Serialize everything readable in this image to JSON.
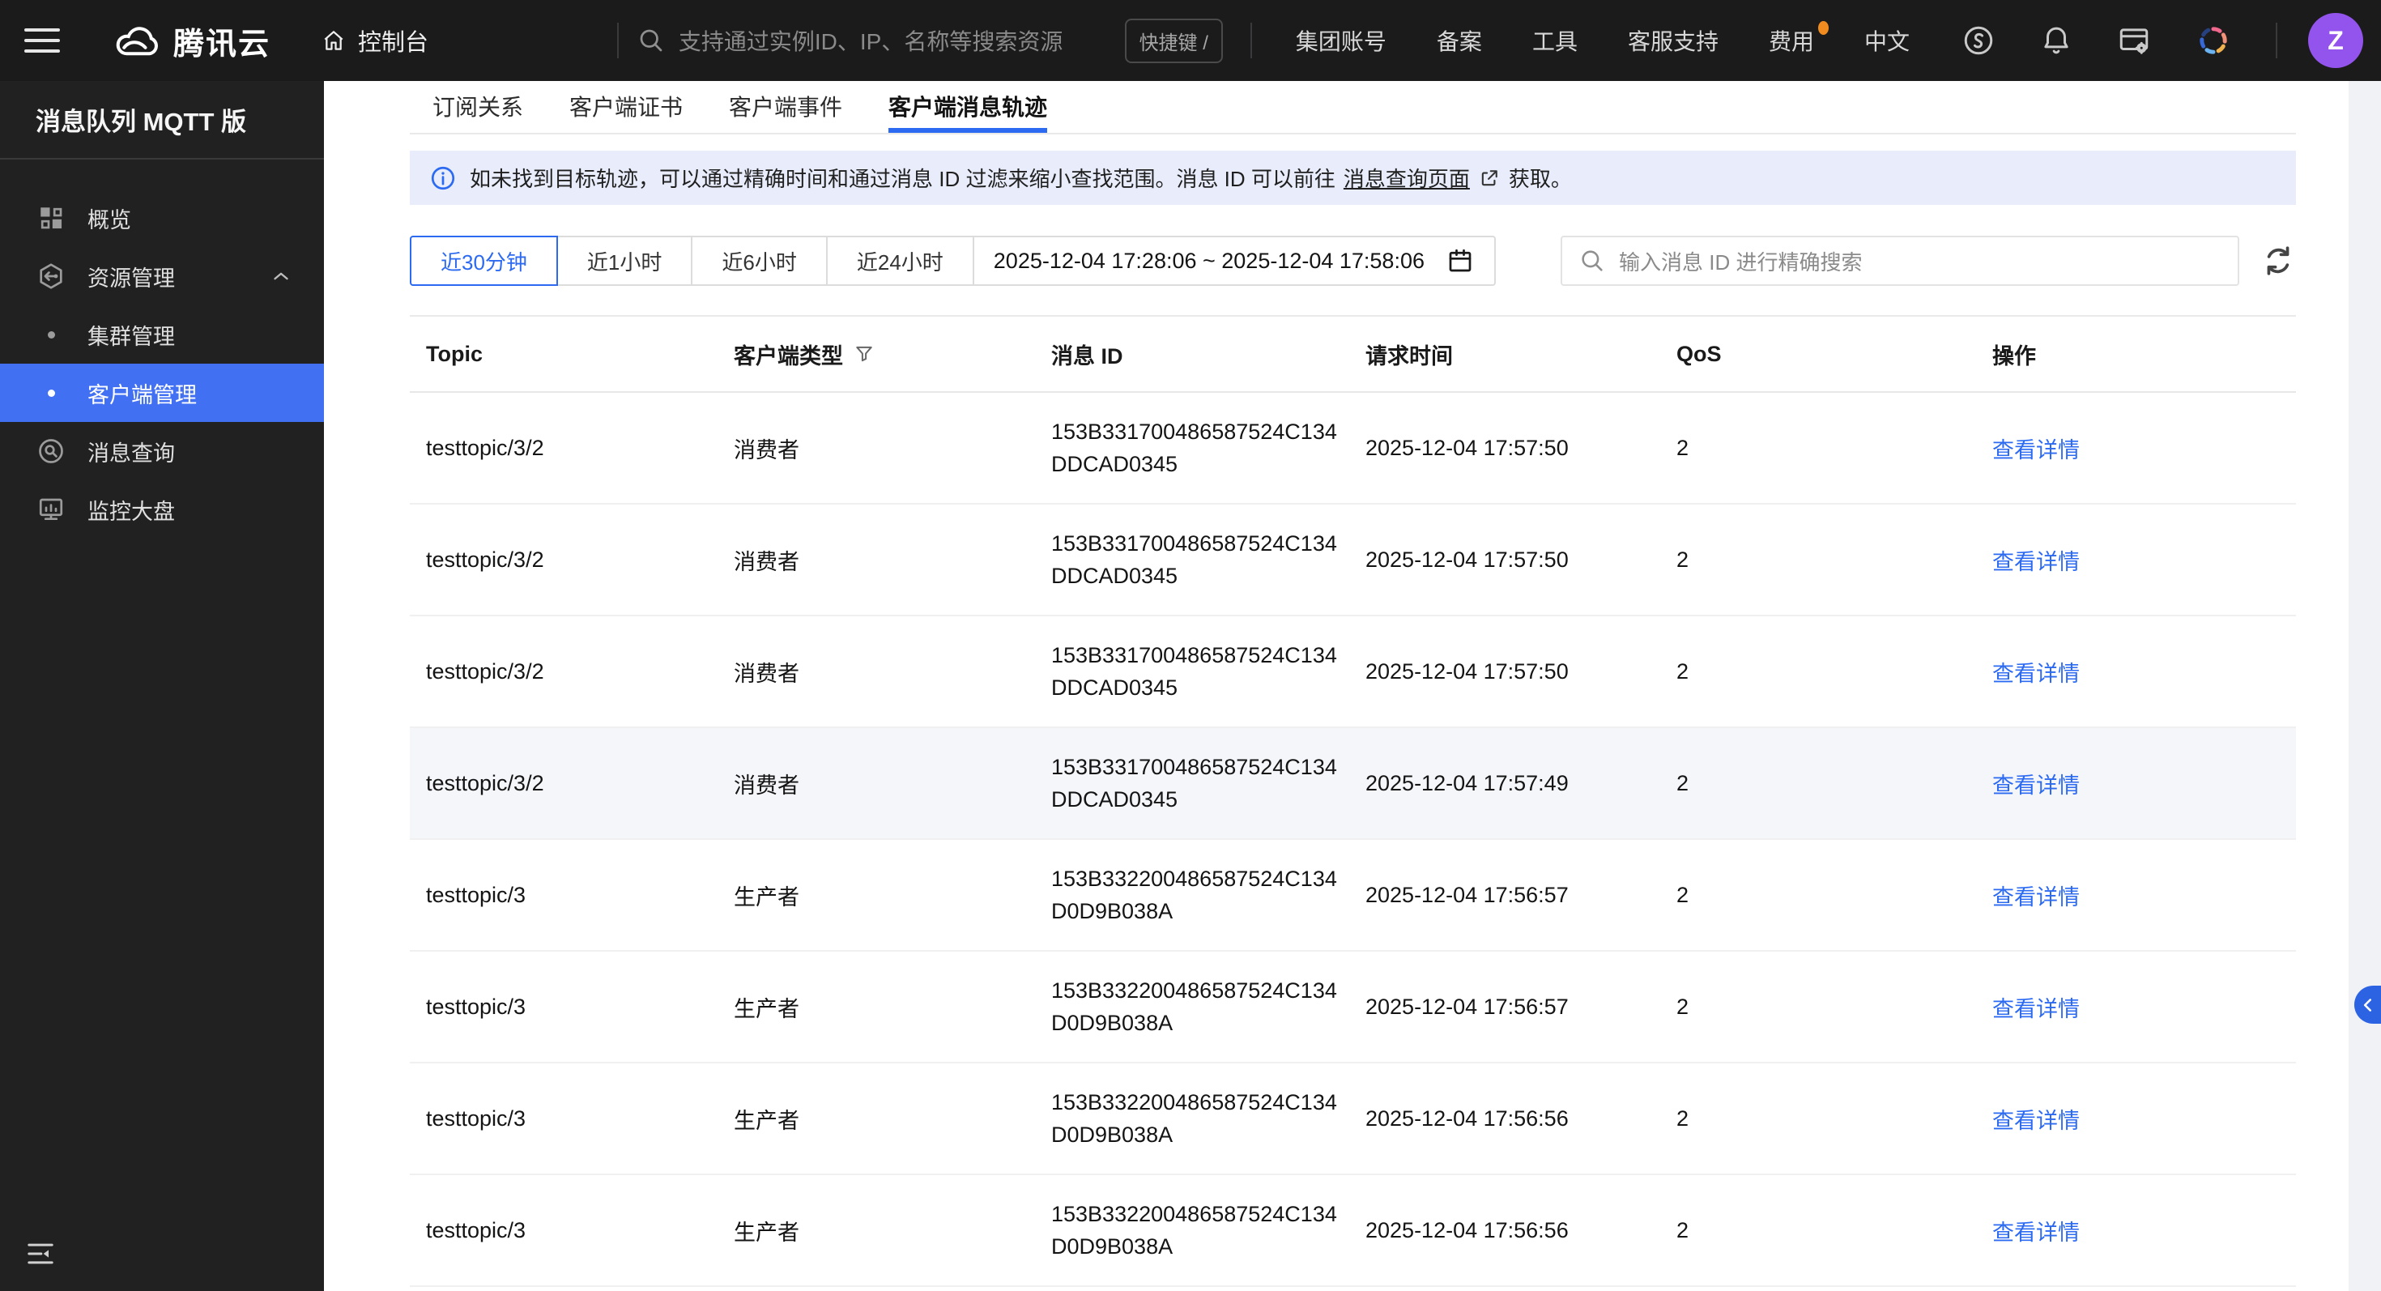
{
  "colors": {
    "accent": "#2c6af2",
    "sidebar_selected": "#4270f3",
    "banner_bg": "#e8ecfb",
    "avatar_bg": "#9254ec",
    "fee_dot": "#f08c1f",
    "toggle_bg": "#2b63e3",
    "topbar_bg": "#1b1b1b",
    "sidebar_bg": "#212121"
  },
  "topbar": {
    "logo_text": "腾讯云",
    "console_label": "控制台",
    "search_placeholder": "支持通过实例ID、IP、名称等搜索资源",
    "shortcut_badge": "快捷键 /",
    "menu_items": [
      {
        "label": "集团账号"
      },
      {
        "label": "备案"
      },
      {
        "label": "工具"
      },
      {
        "label": "客服支持"
      },
      {
        "label": "费用",
        "dot": true
      },
      {
        "label": "中文"
      }
    ],
    "icon_names": [
      "support-icon",
      "bell-icon",
      "console-settings-icon",
      "ai-assistant-icon"
    ],
    "avatar_text": "Z"
  },
  "sidebar": {
    "title": "消息队列 MQTT 版",
    "items": [
      {
        "label": "概览",
        "type": "top",
        "icon": "grid-icon"
      },
      {
        "label": "资源管理",
        "type": "group",
        "icon": "resource-icon",
        "expanded": true
      },
      {
        "label": "集群管理",
        "type": "sub"
      },
      {
        "label": "客户端管理",
        "type": "sub",
        "selected": true
      },
      {
        "label": "消息查询",
        "type": "top",
        "icon": "message-search-icon"
      },
      {
        "label": "监控大盘",
        "type": "top",
        "icon": "monitor-icon"
      }
    ]
  },
  "tabs": {
    "items": [
      "订阅关系",
      "客户端证书",
      "客户端事件",
      "客户端消息轨迹"
    ],
    "active_index": 3
  },
  "banner": {
    "text_before": "如未找到目标轨迹，可以通过精确时间和通过消息 ID 过滤来缩小查找范围。消息 ID 可以前往",
    "link_text": "消息查询页面",
    "text_after": "获取。"
  },
  "filters": {
    "time_ranges": [
      "近30分钟",
      "近1小时",
      "近6小时",
      "近24小时"
    ],
    "active_index": 0,
    "date_range": "2025-12-04 17:28:06 ~ 2025-12-04 17:58:06",
    "search_placeholder": "输入消息 ID 进行精确搜索"
  },
  "table": {
    "columns": [
      "Topic",
      "客户端类型",
      "消息 ID",
      "请求时间",
      "QoS",
      "操作"
    ],
    "action_label": "查看详情",
    "rows": [
      {
        "topic": "testtopic/3/2",
        "client_type": "消费者",
        "message_id": "153B331700486587524C134DDCAD0345",
        "request_time": "2025-12-04 17:57:50",
        "qos": "2"
      },
      {
        "topic": "testtopic/3/2",
        "client_type": "消费者",
        "message_id": "153B331700486587524C134DDCAD0345",
        "request_time": "2025-12-04 17:57:50",
        "qos": "2"
      },
      {
        "topic": "testtopic/3/2",
        "client_type": "消费者",
        "message_id": "153B331700486587524C134DDCAD0345",
        "request_time": "2025-12-04 17:57:50",
        "qos": "2"
      },
      {
        "topic": "testtopic/3/2",
        "client_type": "消费者",
        "message_id": "153B331700486587524C134DDCAD0345",
        "request_time": "2025-12-04 17:57:49",
        "qos": "2",
        "highlighted": true
      },
      {
        "topic": "testtopic/3",
        "client_type": "生产者",
        "message_id": "153B332200486587524C134D0D9B038A",
        "request_time": "2025-12-04 17:56:57",
        "qos": "2"
      },
      {
        "topic": "testtopic/3",
        "client_type": "生产者",
        "message_id": "153B332200486587524C134D0D9B038A",
        "request_time": "2025-12-04 17:56:57",
        "qos": "2"
      },
      {
        "topic": "testtopic/3",
        "client_type": "生产者",
        "message_id": "153B332200486587524C134D0D9B038A",
        "request_time": "2025-12-04 17:56:56",
        "qos": "2"
      },
      {
        "topic": "testtopic/3",
        "client_type": "生产者",
        "message_id": "153B332200486587524C134D0D9B038A",
        "request_time": "2025-12-04 17:56:56",
        "qos": "2"
      }
    ]
  }
}
